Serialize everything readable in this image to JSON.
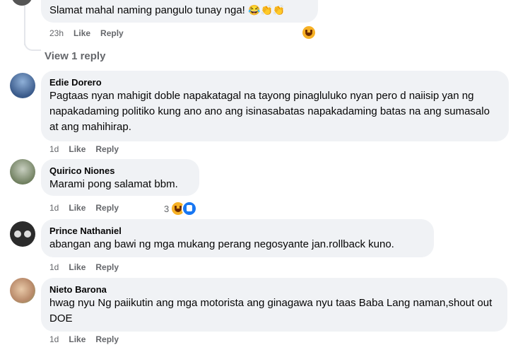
{
  "reply_comment": {
    "text": "Slamat mahal naming pangulo tunay nga! ",
    "emoji": "😂👏👏",
    "time": "23h",
    "like_label": "Like",
    "reply_label": "Reply",
    "reaction_emoji": "😆"
  },
  "view_replies": {
    "label": "View 1 reply"
  },
  "comments": [
    {
      "author": "Edie Dorero",
      "text": "Pagtaas nyan mahigit doble napakatagal na tayong pinagluluko nyan pero d naiisip yan ng napakadaming politiko kung ano ano ang isinasabatas napakadaming batas na ang sumasalo at ang mahihirap.",
      "time": "1d",
      "like_label": "Like",
      "reply_label": "Reply",
      "avatar_color": "#3a5a8a"
    },
    {
      "author": "Quirico Niones",
      "text": "Marami pong salamat bbm.",
      "time": "1d",
      "like_label": "Like",
      "reply_label": "Reply",
      "reaction_count": "3",
      "avatar_color": "#6b7b5a"
    },
    {
      "author": "Prince Nathaniel",
      "text": "abangan ang bawi ng mga mukang perang negosyante jan.rollback kuno.",
      "time": "1d",
      "like_label": "Like",
      "reply_label": "Reply",
      "avatar_color": "#2b2b2b"
    },
    {
      "author": "Nieto Barona",
      "text": "hwag nyu Ng paiikutin ang mga motorista ang ginagawa nyu taas Baba Lang naman,shout out DOE",
      "time": "1d",
      "like_label": "Like",
      "reply_label": "Reply",
      "avatar_color": "#b98a6a"
    }
  ]
}
